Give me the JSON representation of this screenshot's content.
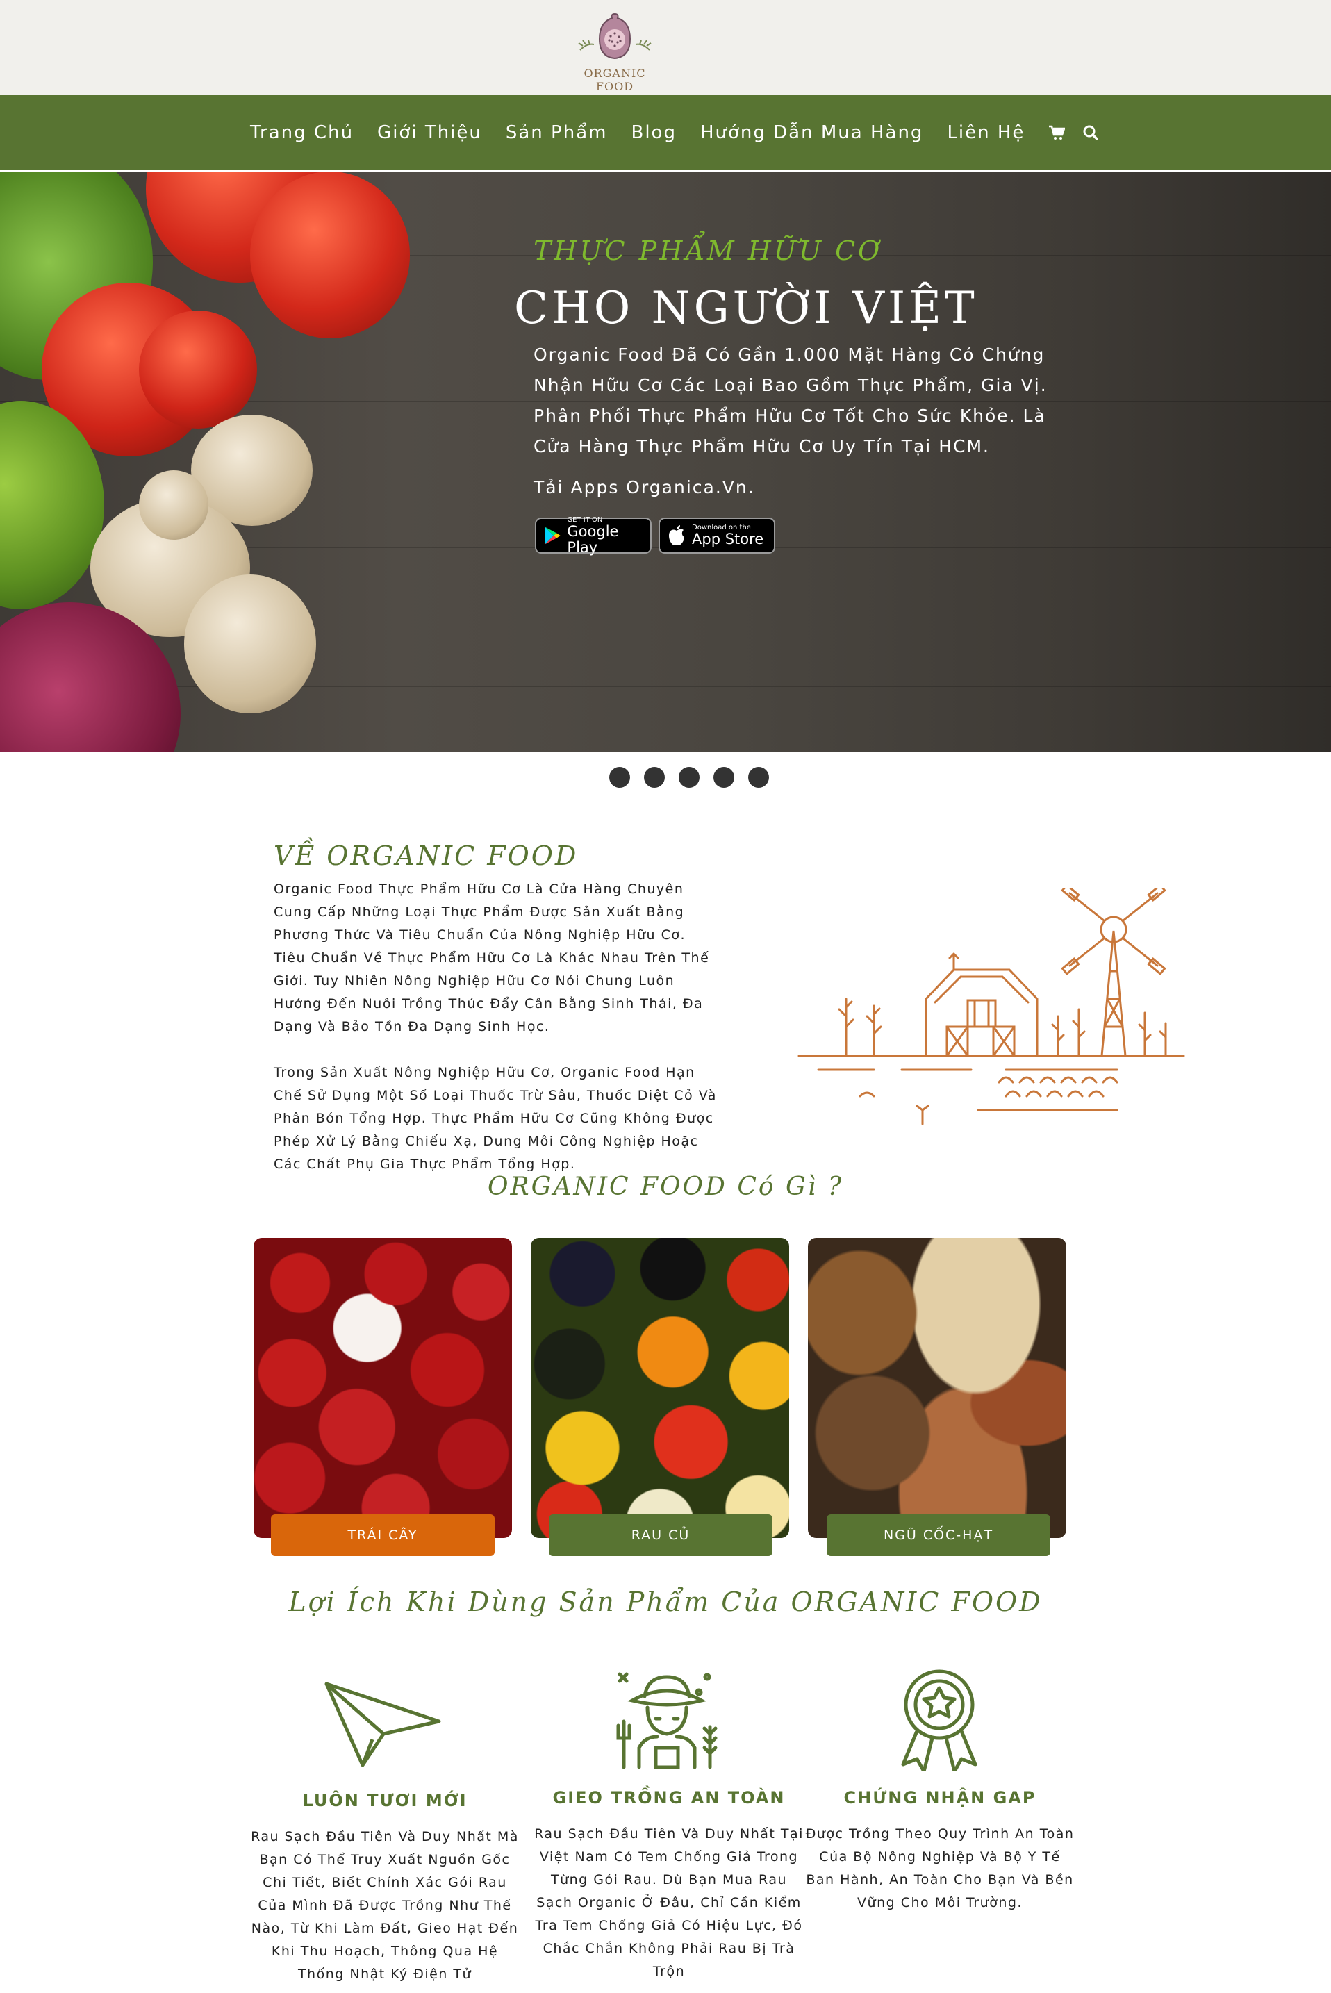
{
  "brand": {
    "logo_text": "ORGANIC FOOD"
  },
  "nav": {
    "items": [
      "Trang Chủ",
      "Giới Thiệu",
      "Sản Phẩm",
      "Blog",
      "Hướng Dẫn Mua Hàng",
      "Liên Hệ"
    ],
    "icons": [
      "cart-icon",
      "search-icon"
    ]
  },
  "hero": {
    "kicker": "THỰC PHẨM HỮU CƠ",
    "title": "CHO NGƯỜI VIỆT",
    "text": "Organic Food Đã Có Gần 1.000 Mặt Hàng Có Chứng Nhận Hữu Cơ Các Loại Bao Gồm Thực Phẩm, Gia Vị. Phân Phối Thực Phẩm Hữu Cơ Tốt Cho Sức Khỏe. Là Cửa Hàng Thực Phẩm Hữu Cơ Uy Tín Tại HCM.",
    "apps_label": "Tải Apps Organica.Vn.",
    "google_play": {
      "small": "GET IT ON",
      "big": "Google Play"
    },
    "app_store": {
      "small": "Download on the",
      "big": "App Store"
    },
    "slide_count": 5
  },
  "about": {
    "title": "VỀ ORGANIC FOOD",
    "paragraphs": [
      "Organic Food Thực Phẩm Hữu Cơ Là Cửa Hàng Chuyên Cung Cấp Những Loại Thực Phẩm Được Sản Xuất Bằng Phương Thức Và Tiêu Chuẩn Của Nông Nghiệp Hữu Cơ. Tiêu Chuẩn Về Thực Phẩm Hữu Cơ Là Khác Nhau Trên Thế Giới. Tuy Nhiên Nông Nghiệp Hữu Cơ Nói Chung Luôn Hướng Đến Nuôi Trồng Thúc Đẩy Cân Bằng Sinh Thái, Đa Dạng Và Bảo Tồn Đa Dạng Sinh Học.",
      "Trong Sản Xuất Nông Nghiệp Hữu Cơ, Organic Food Hạn Chế Sử Dụng Một Số Loại Thuốc Trừ Sâu, Thuốc Diệt Cỏ Và Phân Bón Tổng Hợp. Thực Phẩm Hữu Cơ Cũng Không Được Phép Xử Lý Bằng Chiếu Xạ, Dung Môi Công Nghiệp Hoặc Các Chất Phụ Gia Thực Phẩm Tổng Hợp."
    ]
  },
  "whats": {
    "title": "ORGANIC FOOD Có Gì ?",
    "categories": [
      {
        "label": "TRÁI CÂY",
        "color": "#d9660b"
      },
      {
        "label": "RAU CỦ",
        "color": "#587432"
      },
      {
        "label": "NGŨ CỐC-HẠT",
        "color": "#587432"
      }
    ]
  },
  "benefits": {
    "title": "Lợi Ích Khi Dùng Sản Phẩm Của ORGANIC FOOD",
    "items": [
      {
        "icon": "paper-plane-icon",
        "heading": "LUÔN TƯƠI MỚI",
        "text": "Rau Sạch Đầu Tiên Và Duy Nhất Mà Bạn Có Thể Truy Xuất Nguồn Gốc Chi Tiết, Biết Chính Xác Gói Rau Của Mình Đã Được Trồng Như Thế Nào, Từ Khi Làm Đất, Gieo Hạt Đến Khi Thu Hoạch, Thông Qua Hệ Thống Nhật Ký Điện Tử"
      },
      {
        "icon": "farmer-icon",
        "heading": "GIEO TRỒNG AN TOÀN",
        "text": "Rau Sạch Đầu Tiên Và Duy Nhất Tại Việt Nam Có Tem Chống Giả Trong Từng Gói Rau. Dù Bạn Mua Rau Sạch Organic Ở Đâu, Chỉ Cần Kiểm Tra Tem Chống Giả Có Hiệu Lực, Đó Chắc Chắn Không Phải Rau Bị Trà Trộn"
      },
      {
        "icon": "award-badge-icon",
        "heading": "CHỨNG NHẬN GAP",
        "text": "Được Trồng Theo Quy Trình An Toàn Của Bộ Nông Nghiệp Và Bộ Y Tế Ban Hành, An Toàn Cho Bạn Và Bền Vững Cho Môi Trường."
      }
    ]
  },
  "colors": {
    "primary_green": "#587432",
    "accent_orange": "#d9660b",
    "header_bg": "#f1f0ec",
    "hero_kicker": "#7fb92e"
  }
}
